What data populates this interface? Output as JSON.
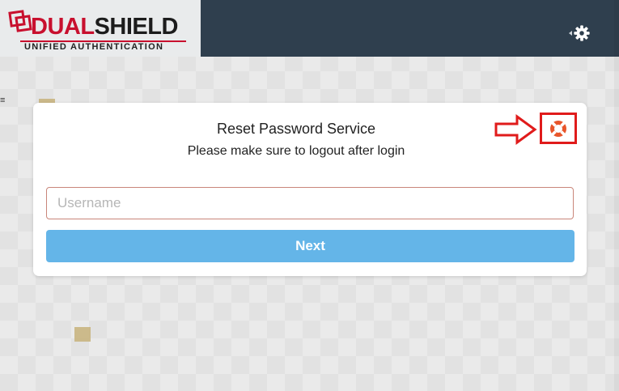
{
  "brand": {
    "name_part1": "DUAL",
    "name_part2": "SHIELD",
    "tagline": "UNIFIED AUTHENTICATION",
    "primary_color": "#c8102e"
  },
  "header": {
    "settings_icon": "gear-icon",
    "background_color": "#2f3f4e"
  },
  "card": {
    "title": "Reset Password Service",
    "subtitle": "Please make sure to logout after login",
    "help_icon": "lifebuoy-icon",
    "annotation_color": "#e01b1b"
  },
  "form": {
    "username_placeholder": "Username",
    "username_value": "",
    "next_label": "Next",
    "next_color": "#64b5e8"
  }
}
